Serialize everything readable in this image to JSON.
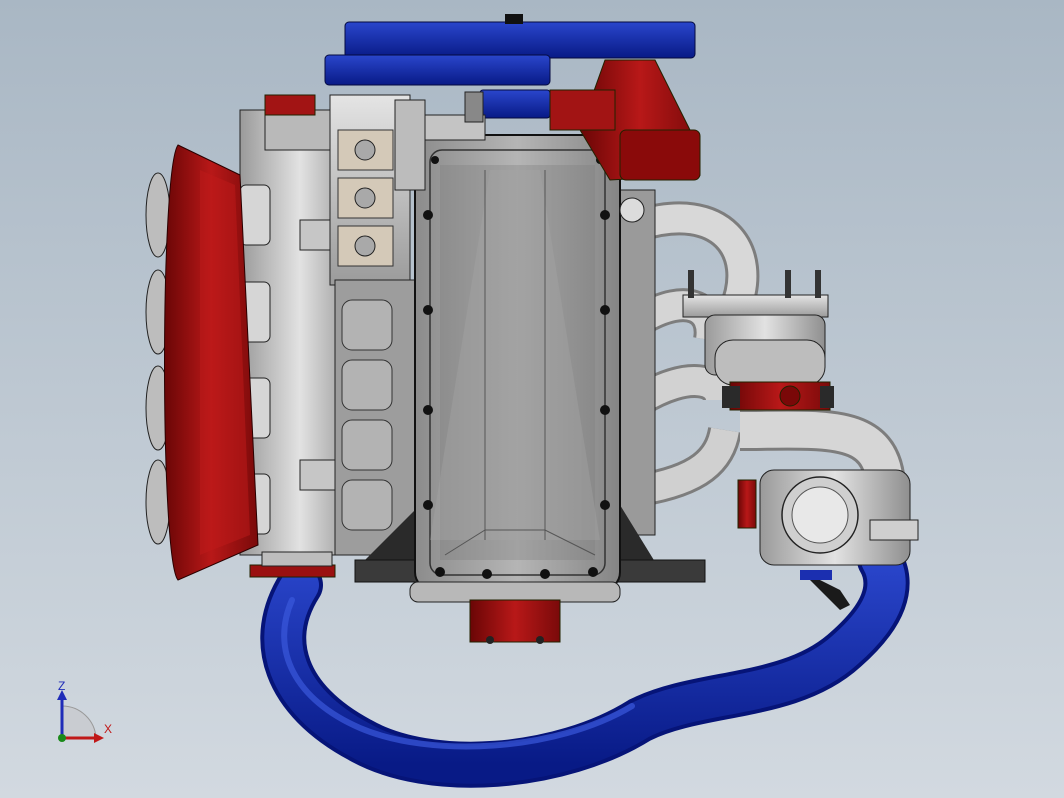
{
  "viewport": {
    "background_top": "#a9b7c4",
    "background_bottom": "#d2d9e0"
  },
  "model": {
    "colors": {
      "metal": "#c9c9c9",
      "metal_dark": "#8e8e8e",
      "red": "#a01010",
      "red_dark": "#6e0808",
      "blue": "#0a1f9a",
      "blue_light": "#2440c8",
      "pipe": "#cfcfcf",
      "outline": "#1a1a1a"
    }
  },
  "triad": {
    "z_label": "Z",
    "x_label": "X",
    "z_color": "#1f2cb8",
    "x_color": "#c01818",
    "y_color": "#1a8a1a"
  }
}
